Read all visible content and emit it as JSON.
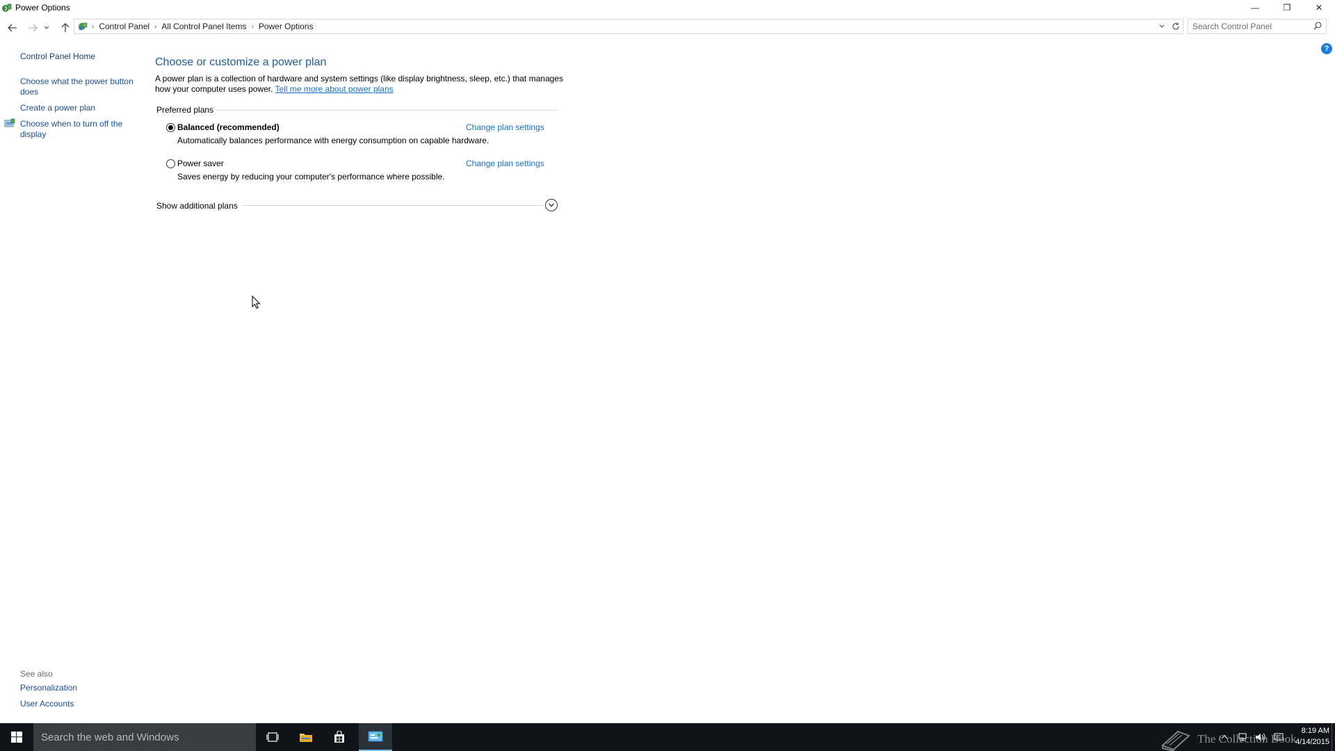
{
  "window": {
    "title": "Power Options",
    "minimize_glyph": "—",
    "restore_glyph": "❐",
    "close_glyph": "✕"
  },
  "address_bar": {
    "breadcrumbs": [
      "Control Panel",
      "All Control Panel Items",
      "Power Options"
    ],
    "search_placeholder": "Search Control Panel"
  },
  "left_pane": {
    "home_link": "Control Panel Home",
    "links": [
      "Choose what the power button does",
      "Create a power plan",
      "Choose when to turn off the display"
    ],
    "see_also_label": "See also",
    "see_also_links": [
      "Personalization",
      "User Accounts"
    ]
  },
  "main": {
    "heading": "Choose or customize a power plan",
    "description": "A power plan is a collection of hardware and system settings (like display brightness, sleep, etc.) that manages how your computer uses power.",
    "learn_more_link": "Tell me more about power plans",
    "preferred_plans_label": "Preferred plans",
    "plans": [
      {
        "name": "Balanced (recommended)",
        "description": "Automatically balances performance with energy consumption on capable hardware.",
        "selected": true,
        "link": "Change plan settings"
      },
      {
        "name": "Power saver",
        "description": "Saves energy by reducing your computer's performance where possible.",
        "selected": false,
        "link": "Change plan settings"
      }
    ],
    "show_additional_label": "Show additional plans"
  },
  "taskbar": {
    "search_placeholder": "Search the web and Windows",
    "clock_time": "8:19 AM",
    "clock_date": "4/14/2015",
    "watermark_text": "The Collection Book"
  },
  "colors": {
    "link_blue": "#1a6fcf",
    "heading_blue": "#1e5c99",
    "taskbar_bg": "#101418",
    "help_blue": "#1a7ed4"
  }
}
